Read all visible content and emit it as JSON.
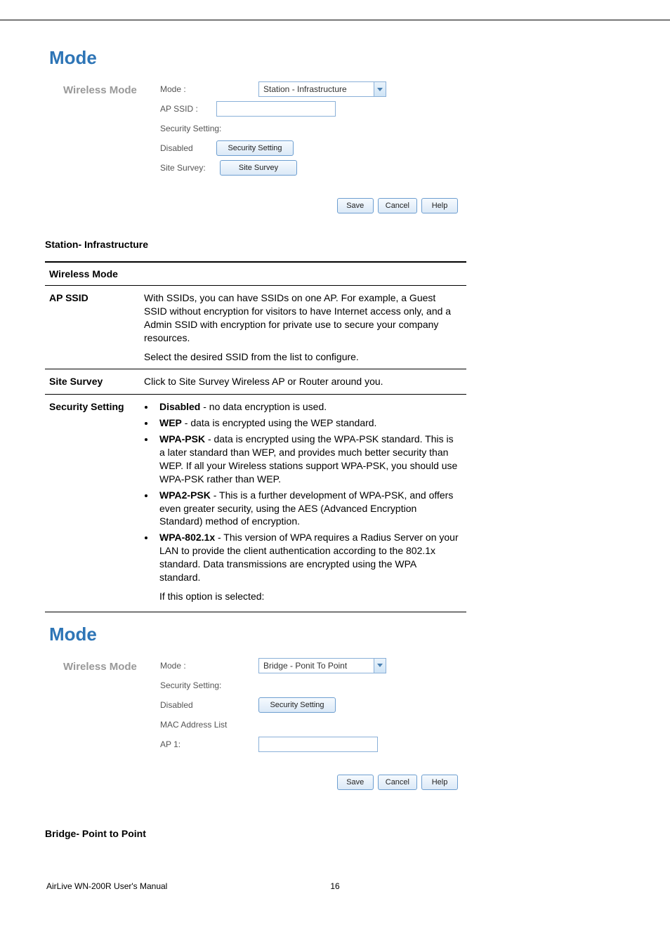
{
  "panel1": {
    "title": "Mode",
    "section_label": "Wireless Mode",
    "mode_label": "Mode :",
    "mode_value": "Station - Infrastructure",
    "ap_ssid_label": "AP SSID :",
    "ap_ssid_value": "",
    "security_setting_label": "Security Setting:",
    "security_status": "Disabled",
    "security_button": "Security Setting",
    "site_survey_label": "Site Survey:",
    "site_survey_button": "Site Survey",
    "save": "Save",
    "cancel": "Cancel",
    "help": "Help"
  },
  "caption1": "Station- Infrastructure",
  "table1": {
    "header": "Wireless Mode",
    "row1_key": "AP SSID",
    "row1_p1": "With SSIDs, you can have  SSIDs on one AP. For example, a Guest SSID without encryption for visitors to have Internet access only, and a Admin SSID with encryption for private use to secure your company resources.",
    "row1_p2": "Select the desired SSID from the list to configure.",
    "row2_key": "Site Survey",
    "row2_val": "Click to Site Survey Wireless AP or Router around you.",
    "row3_key": "Security Setting",
    "sec_disabled_b": "Disabled",
    "sec_disabled_t": " - no data encryption is used.",
    "sec_wep_b": "WEP",
    "sec_wep_t": " - data is encrypted using the WEP standard.",
    "sec_wpapsk_b": "WPA-PSK",
    "sec_wpapsk_t": " - data is encrypted using the WPA-PSK standard. This is a later standard than WEP, and provides much better security than WEP. If all your Wireless stations support WPA-PSK, you should use WPA-PSK rather than WEP.",
    "sec_wpa2psk_b": "WPA2-PSK",
    "sec_wpa2psk_t": " - This is a further development of WPA-PSK, and offers even greater security, using the AES (Advanced Encryption Standard) method of encryption.",
    "sec_wpa8021x_b": "WPA-802.1x",
    "sec_wpa8021x_t": " - This version of WPA requires a Radius Server on your LAN to provide the client authentication according to the 802.1x standard. Data transmissions are encrypted using the WPA standard.",
    "sec_tail": "If this option is selected:"
  },
  "panel2": {
    "title": "Mode",
    "section_label": "Wireless Mode",
    "mode_label": "Mode :",
    "mode_value": "Bridge - Ponit To Point",
    "security_setting_label": "Security Setting:",
    "security_status": "Disabled",
    "security_button": "Security Setting",
    "mac_label": "MAC Address List",
    "ap1_label": "AP 1:",
    "ap1_value": "",
    "save": "Save",
    "cancel": "Cancel",
    "help": "Help"
  },
  "caption2": "Bridge- Point to Point",
  "footer": {
    "left": "AirLive WN-200R User's Manual",
    "page": "16"
  }
}
